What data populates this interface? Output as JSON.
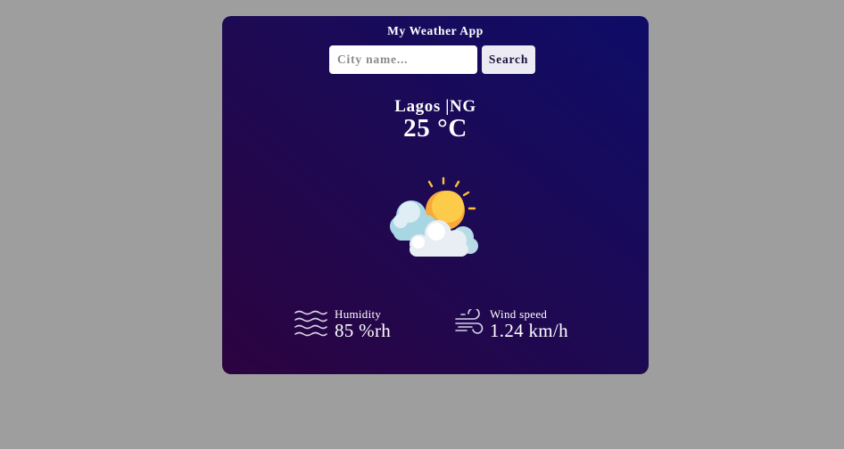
{
  "app": {
    "title": "My Weather App"
  },
  "search": {
    "placeholder": "City name...",
    "value": "",
    "button_label": "Search"
  },
  "weather": {
    "location": "Lagos |NG",
    "temperature": "25 °C",
    "condition_icon": "partly-cloudy-icon"
  },
  "details": {
    "humidity": {
      "label": "Humidity",
      "value": "85 %rh",
      "icon": "humidity-waves-icon"
    },
    "wind": {
      "label": "Wind speed",
      "value": "1.24 km/h",
      "icon": "wind-icon"
    }
  },
  "colors": {
    "page_background": "#9e9e9e",
    "card_gradient_top": "#0e0c68",
    "card_gradient_bottom": "#2c0340",
    "text": "#ffffff",
    "sun": "#fdbf3a",
    "cloud": "#e8eef3"
  }
}
